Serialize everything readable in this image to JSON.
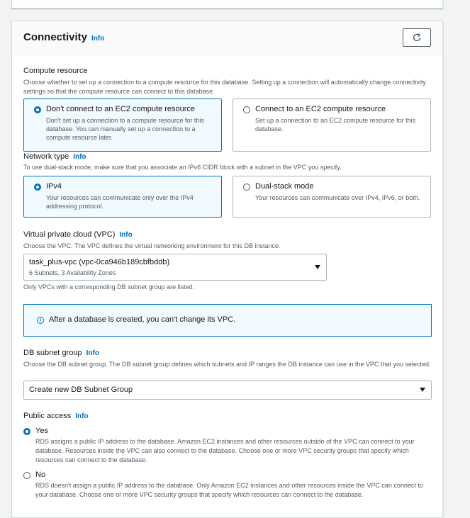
{
  "section": {
    "title": "Connectivity",
    "info": "Info"
  },
  "compute": {
    "label": "Compute resource",
    "description": "Choose whether to set up a connection to a compute resource for this database. Setting up a connection will automatically change connectivity settings so that the compute resource can connect to this database.",
    "options": [
      {
        "title": "Don't connect to an EC2 compute resource",
        "desc": "Don't set up a connection to a compute resource for this database. You can manually set up a connection to a compute resource later.",
        "selected": true
      },
      {
        "title": "Connect to an EC2 compute resource",
        "desc": "Set up a connection to an EC2 compute resource for this database.",
        "selected": false
      }
    ]
  },
  "network": {
    "label": "Network type",
    "info": "Info",
    "description": "To use dual-stack mode, make sure that you associate an IPv6 CIDR block with a subnet in the VPC you specify.",
    "options": [
      {
        "title": "IPv4",
        "desc": "Your resources can communicate only over the IPv4 addressing protocol.",
        "selected": true
      },
      {
        "title": "Dual-stack mode",
        "desc": "Your resources can communicate over IPv4, IPv6, or both.",
        "selected": false
      }
    ]
  },
  "vpc": {
    "label": "Virtual private cloud (VPC)",
    "info": "Info",
    "description": "Choose the VPC. The VPC defines the virtual networking environment for this DB instance.",
    "value": "task_plus-vpc (vpc-0ca946b189cbfbddb)",
    "sub": "6 Subnets, 3 Availability Zones",
    "constraint": "Only VPCs with a corresponding DB subnet group are listed.",
    "alert": "After a database is created, you can't change its VPC."
  },
  "subnet": {
    "label": "DB subnet group",
    "info": "Info",
    "description": "Choose the DB subnet group. The DB subnet group defines which subnets and IP ranges the DB instance can use in the VPC that you selected.",
    "value": "Create new DB Subnet Group"
  },
  "public_access": {
    "label": "Public access",
    "info": "Info",
    "options": [
      {
        "title": "Yes",
        "desc": "RDS assigns a public IP address to the database. Amazon EC2 instances and other resources outside of the VPC can connect to your database. Resources inside the VPC can also connect to the database. Choose one or more VPC security groups that specify which resources can connect to the database.",
        "selected": true
      },
      {
        "title": "No",
        "desc": "RDS doesn't assign a public IP address to the database. Only Amazon EC2 instances and other resources inside the VPC can connect to your database. Choose one or more VPC security groups that specify which resources can connect to the database.",
        "selected": false
      }
    ]
  },
  "colors": {
    "accent": "#0073bb",
    "border": "#aab7b8",
    "selected_bg": "#f1faff"
  },
  "icons": [
    "refresh-icon",
    "info-circle-icon",
    "caret-down-icon"
  ]
}
